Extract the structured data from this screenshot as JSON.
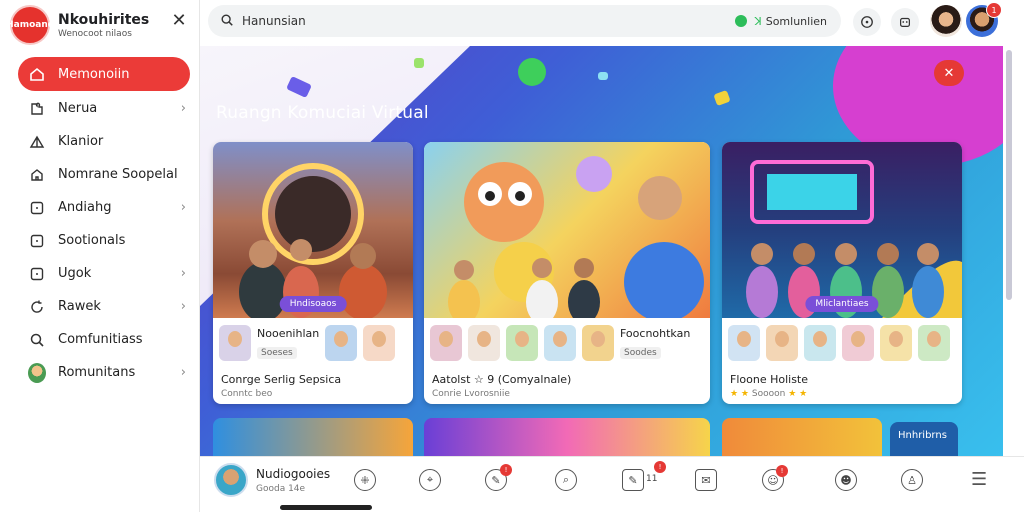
{
  "sidebar": {
    "brand_logo_text": "Hamoane",
    "brand_title": "Nkouhirites",
    "brand_subtitle": "Wenocoot nilaos",
    "nav": [
      {
        "label": "Memonoiin",
        "icon": "home-icon",
        "active": true,
        "chevron": false
      },
      {
        "label": "Nerua",
        "icon": "puzzle-icon",
        "chevron": true
      },
      {
        "label": "Klanior",
        "icon": "tent-icon",
        "chevron": false
      },
      {
        "label": "Nomrane Soopelal",
        "icon": "house-icon",
        "chevron": false
      },
      {
        "label": "Andiahg",
        "icon": "square-icon",
        "chevron": true
      },
      {
        "label": "Sootionals",
        "icon": "square-icon",
        "chevron": false
      },
      {
        "label": "Ugok",
        "icon": "square-icon",
        "chevron": true
      },
      {
        "label": "Rawek",
        "icon": "refresh-icon",
        "chevron": true
      },
      {
        "label": "Comfunitiass",
        "icon": "search-icon",
        "chevron": false
      },
      {
        "label": "Romunitans",
        "icon": "avatar",
        "chevron": true
      }
    ]
  },
  "topbar": {
    "search_value": "Hanunsian",
    "status_text": "Somlunlien",
    "notification_count": "1"
  },
  "hero": {
    "title": "Ruangn Komuciai Virtual"
  },
  "cards": [
    {
      "tag": "Hndisoaos",
      "name": "Nooenihlan",
      "sub": "Soeses",
      "footer": "Conrge Serlig Sepsica",
      "footer_sub": "Conntc beo"
    },
    {
      "tag": "",
      "name": "Foocnohtkan",
      "sub": "Soodes",
      "footer": "Aatolst ☆ 9 (Comyalnale)",
      "footer_sub": "Conrie Lvorosniie"
    },
    {
      "tag": "Mliclantiaes",
      "name": "",
      "sub": "",
      "footer": "Floone Holiste",
      "footer_sub": "Soooon"
    }
  ],
  "card_lower_label": "Hnhribrns",
  "bottombar": {
    "name": "Nudiogooies",
    "sub": "Gooda 14e",
    "icon_count": "11"
  },
  "colors": {
    "accent": "#eb3b38",
    "hero_purple": "#5a3ec7",
    "hero_blue": "#39c0ee",
    "status_green": "#2dbd5a"
  }
}
